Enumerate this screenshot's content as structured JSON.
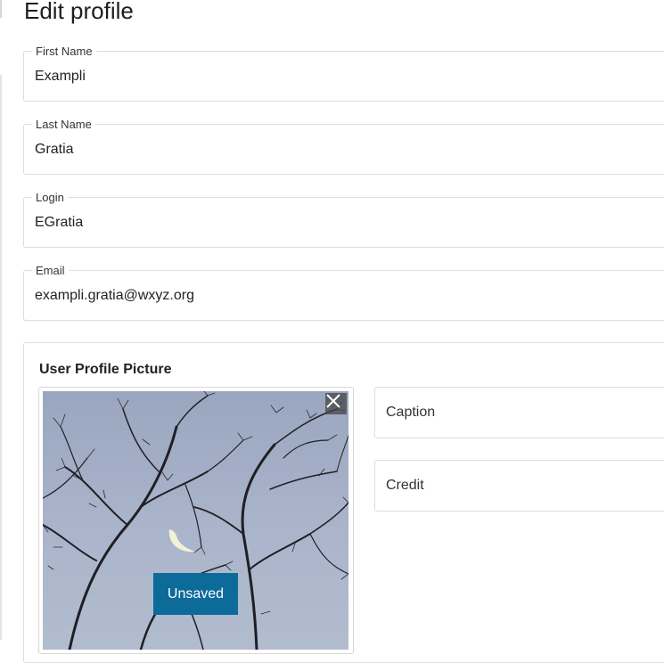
{
  "page": {
    "title": "Edit profile"
  },
  "fields": [
    {
      "label": "First Name",
      "value": "Exampli"
    },
    {
      "label": "Last Name",
      "value": "Gratia"
    },
    {
      "label": "Login",
      "value": "EGratia"
    },
    {
      "label": "Email",
      "value": "exampli.gratia@wxyz.org"
    }
  ],
  "picture": {
    "section_title": "User Profile Picture",
    "status": "Unsaved",
    "remove_icon": "close-icon",
    "caption_placeholder": "Caption",
    "credit_placeholder": "Credit"
  },
  "colors": {
    "badge": "#0d6b9a",
    "sky": "#a9b4cb"
  }
}
